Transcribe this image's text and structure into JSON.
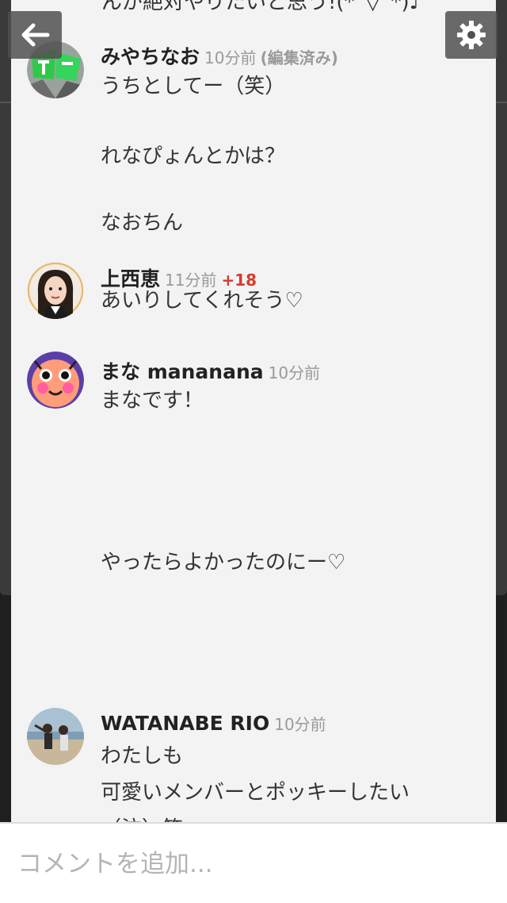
{
  "top_partial_text": "んが絶対やりたいと思う!(*´▽`*)♪",
  "comments": [
    {
      "name": "みやちなお",
      "time": "10分前",
      "edited": "(編集済み)",
      "lines": [
        "うちとしてー（笑）",
        "れなぴょんとかは？",
        "なおちん"
      ]
    },
    {
      "name": "上西恵",
      "time": "11分前",
      "likes": "+18",
      "lines": [
        "あいりしてくれそう♡"
      ]
    },
    {
      "name": "まな mananana",
      "time": "10分前",
      "lines": [
        "まなです！",
        "やったらよかったのにー♡"
      ]
    },
    {
      "name": "WATANABE RIO",
      "time": "10分前",
      "lines": [
        "わたしも",
        "可愛いメンバーとポッキーしたい",
        "（泣）笑"
      ]
    }
  ],
  "input": {
    "placeholder": "コメントを追加..."
  },
  "icons": {
    "back": "arrow-left-icon",
    "settings": "gear-icon"
  },
  "colors": {
    "likes": "#d63b2e",
    "sheet_bg": "#f3f3f3"
  }
}
